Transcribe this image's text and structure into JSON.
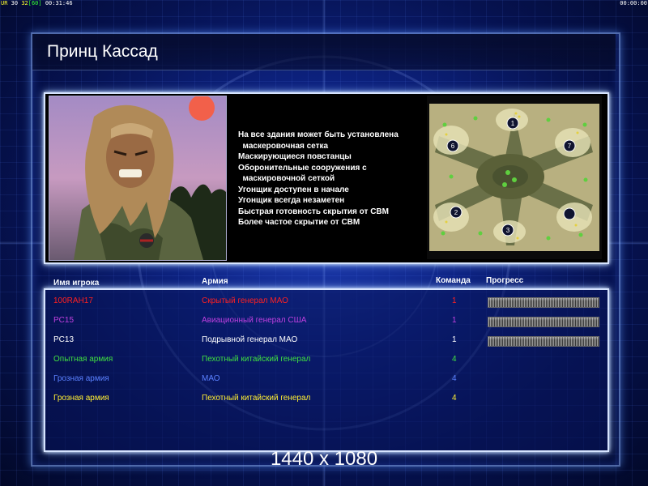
{
  "status_bar": {
    "left_prefix": "UR",
    "left_a": "30",
    "left_b": "32",
    "left_c": "[60]",
    "left_time": "00:31:46",
    "right_time": "00:00:00"
  },
  "general_name": "Принц Кассад",
  "perks": [
    "На все здания может быть установлена",
    "  маскеровочная сетка",
    "Маскирующиеся повстанцы",
    "Оборонительные сооружения с",
    "  маскировочной сеткой",
    "Угонщик доступен в начале",
    "Угонщик всегда незаметен",
    "Быстрая готовность скрытия от СВМ",
    "Более частое скрытие от СВМ"
  ],
  "map": {
    "start_positions": [
      "1",
      "2",
      "3",
      "6",
      "7",
      ""
    ]
  },
  "columns": {
    "player": "Имя игрока",
    "army": "Армия",
    "team": "Команда",
    "progress": "Прогресс"
  },
  "players": [
    {
      "name": "100RAH17",
      "army": "Скрытый генерал МАО",
      "team": "1",
      "color": "#ff2020",
      "progress": 1.0
    },
    {
      "name": "PC15",
      "army": "Авиационный генерал США",
      "team": "1",
      "color": "#c040e0",
      "progress": 1.0
    },
    {
      "name": "PC13",
      "army": "Подрывной генерал МАО",
      "team": "1",
      "color": "#ffffff",
      "progress": 1.0
    },
    {
      "name": "Опытная армия",
      "army": "Пехотный китайский генерал",
      "team": "4",
      "color": "#40e040",
      "progress": null
    },
    {
      "name": "Грозная армия",
      "army": "МАО",
      "team": "4",
      "color": "#5a80ff",
      "progress": null
    },
    {
      "name": "Грозная армия",
      "army": "Пехотный китайский генерал",
      "team": "4",
      "color": "#ffee33",
      "progress": null
    }
  ],
  "resolution_label": "1440 x 1080"
}
